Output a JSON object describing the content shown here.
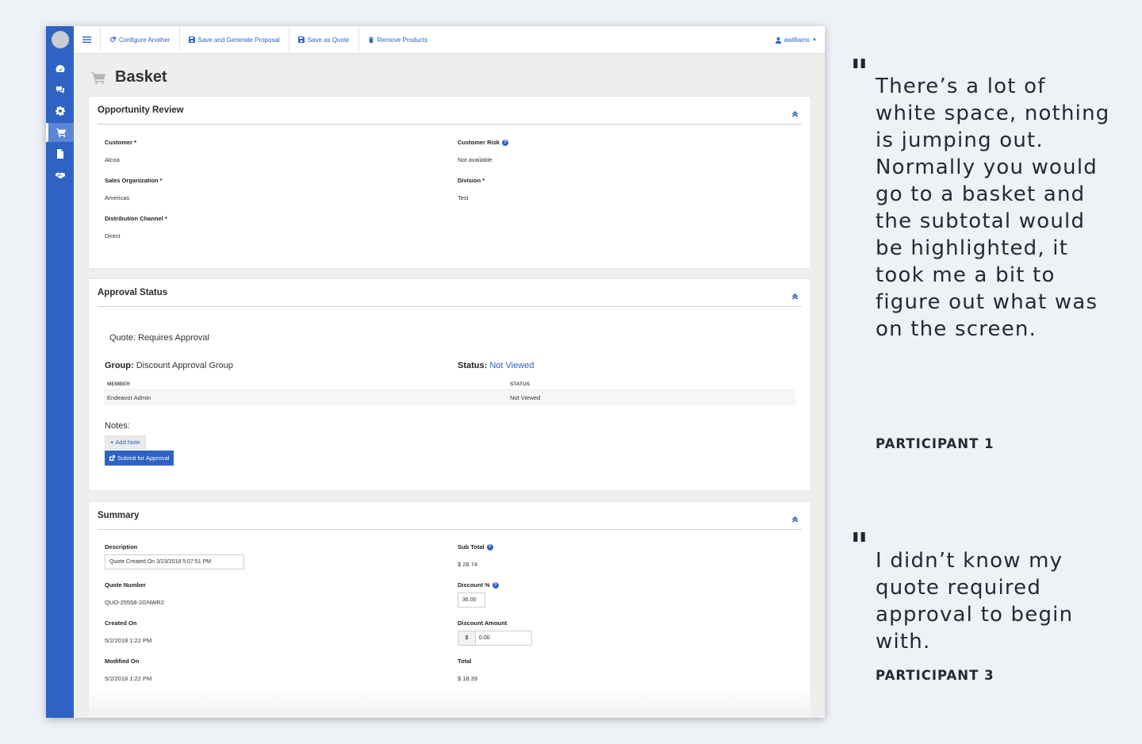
{
  "app": {
    "sidebar": {
      "items": [
        {
          "icon": "dashboard-icon"
        },
        {
          "icon": "chat-icon"
        },
        {
          "icon": "gear-icon"
        },
        {
          "icon": "cart-icon",
          "active": true
        },
        {
          "icon": "document-icon"
        },
        {
          "icon": "handshake-icon"
        }
      ]
    },
    "topbar": {
      "configure_another": "Configure Another",
      "save_generate_proposal": "Save and Generate Proposal",
      "save_as_quote": "Save as Quote",
      "remove_products": "Remove Products",
      "user": "awilliams"
    },
    "page_title": "Basket",
    "opportunity_review": {
      "title": "Opportunity Review",
      "customer_label": "Customer *",
      "customer_value": "Alcoa",
      "customer_risk_label": "Customer Risk",
      "customer_risk_value": "Not available",
      "sales_org_label": "Sales Organization *",
      "sales_org_value": "Americas",
      "division_label": "Division *",
      "division_value": "Test",
      "distribution_channel_label": "Distribution Channel *",
      "distribution_channel_value": "Direct"
    },
    "approval_status": {
      "title": "Approval Status",
      "quote_line": "Quote: Requires Approval",
      "group_label": "Group:",
      "group_value": "Discount Approval Group",
      "status_label": "Status:",
      "status_value": "Not Viewed",
      "table_headers": [
        "MEMBER",
        "STATUS"
      ],
      "table_rows": [
        [
          "Endeavor Admin",
          "Not Viewed"
        ]
      ],
      "notes_label": "Notes:",
      "add_note": "Add Note",
      "submit_for_approval": "Submit for Approval"
    },
    "summary": {
      "title": "Summary",
      "description_label": "Description",
      "description_value": "Quote Created On 3/23/2018 5:07:51 PM",
      "quote_number_label": "Quote Number",
      "quote_number_value": "QUO-25558-2GNWR2",
      "created_on_label": "Created On",
      "created_on_value": "5/2/2018 1:22 PM",
      "modified_on_label": "Modified On",
      "modified_on_value": "5/2/2018 1:22 PM",
      "subtotal_label": "Sub Total",
      "subtotal_value": "$ 28.74",
      "discount_pct_label": "Discount %",
      "discount_pct_value": "36.00",
      "discount_amount_label": "Discount Amount",
      "discount_amount_prefix": "$",
      "discount_amount_value": "0.00",
      "total_label": "Total",
      "total_value": "$ 18.39"
    }
  },
  "quotes": [
    {
      "text": "There’s a lot of white space, nothing is jumping out. Normally you would go to a basket and the subtotal would be highlighted, it took me a bit to figure out what was on the screen.",
      "participant": "PARTICIPANT 1"
    },
    {
      "text": "I didn’t know my quote required approval to begin with.",
      "participant": "PARTICIPANT 3"
    }
  ],
  "colors": {
    "brand_blue": "#2e63c4",
    "background": "#eef2f7"
  }
}
